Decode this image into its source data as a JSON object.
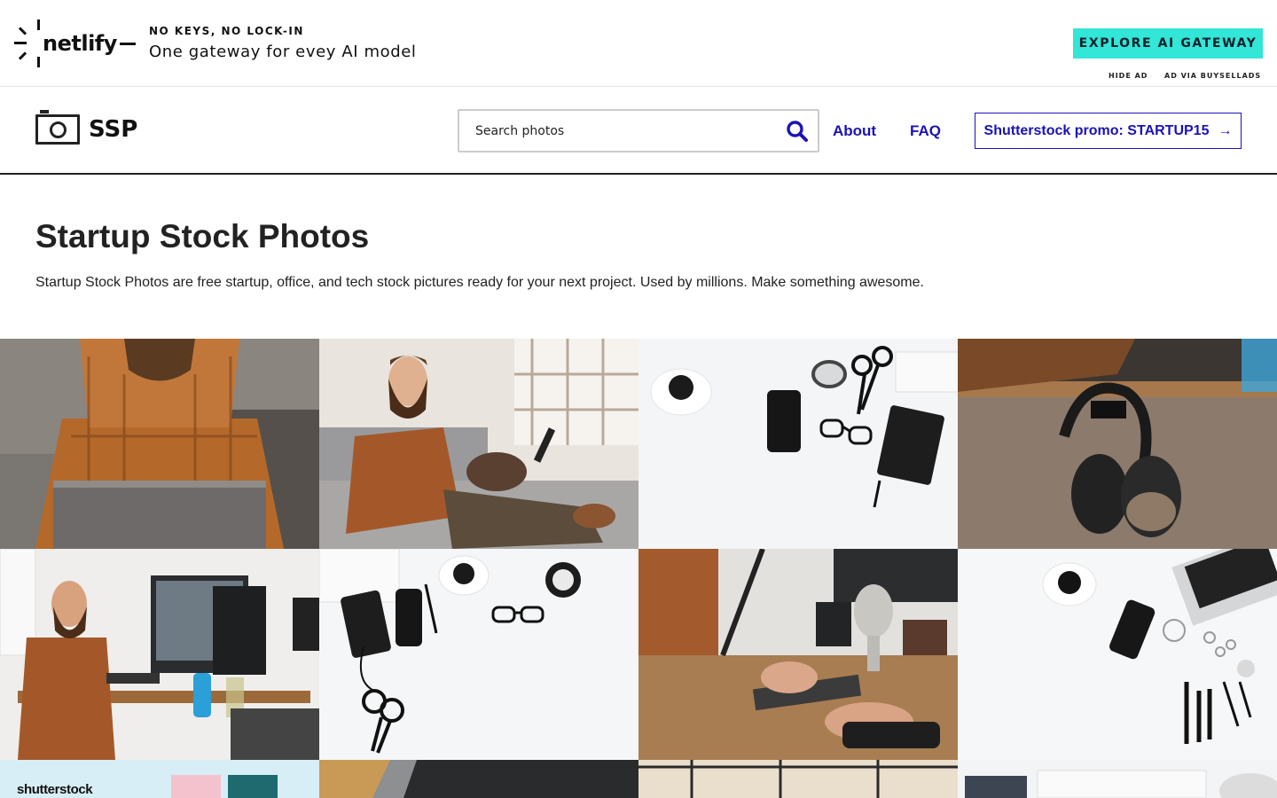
{
  "ad": {
    "brand": "netlify",
    "kicker": "NO KEYS, NO LOCK-IN",
    "tagline": "One gateway for evey AI model",
    "cta": "EXPLORE AI GATEWAY",
    "hide_ad": "HIDE AD",
    "via": "AD VIA BUYSELLADS",
    "cta_color": "#32e6d8"
  },
  "header": {
    "brand_name": "SSP",
    "search_placeholder": "Search photos",
    "nav": {
      "about": "About",
      "faq": "FAQ"
    },
    "promo": "Shutterstock promo: STARTUP15",
    "promo_arrow": "→",
    "link_color": "#1a12b6"
  },
  "hero": {
    "title": "Startup Stock Photos",
    "subtitle": "Startup Stock Photos are free startup, office, and tech stock pictures ready for your next project. Used by millions. Make something awesome."
  },
  "gallery": {
    "photos": [
      {
        "name": "man-typing-laptop-couch"
      },
      {
        "name": "man-on-couch-with-dog-phone"
      },
      {
        "name": "desk-flatlay-scissors-phone-glasses"
      },
      {
        "name": "headphones-hanging-desk"
      },
      {
        "name": "man-standing-desk-monitors"
      },
      {
        "name": "desk-flatlay-notebook-clock"
      },
      {
        "name": "man-typing-microphone-desk"
      },
      {
        "name": "desk-flatlay-makeup-keyboard"
      },
      {
        "name": "shutterstock-ad-tile",
        "label": "shutterstock"
      },
      {
        "name": "laptop-keyboard-closeup"
      },
      {
        "name": "office-window-curtains"
      },
      {
        "name": "keyboard-lamp-flatlay"
      }
    ]
  }
}
